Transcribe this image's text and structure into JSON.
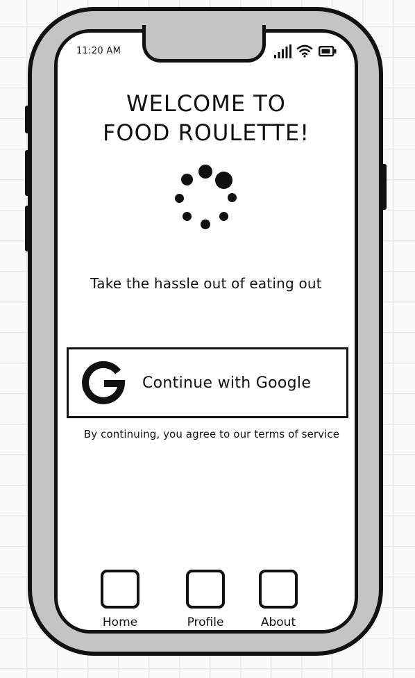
{
  "status_bar": {
    "time": "11:20 AM",
    "icons": [
      "signal-icon",
      "wifi-icon",
      "battery-icon"
    ]
  },
  "main": {
    "title_line1": "WELCOME TO",
    "title_line2": "FOOD ROULETTE!",
    "loading_indicator": "spinner-icon",
    "tagline": "Take the hassle out of eating out"
  },
  "auth": {
    "google_button_label": "Continue with Google",
    "google_icon": "google-g-icon",
    "terms_text": "By continuing, you agree to our terms of service"
  },
  "bottom_nav": {
    "items": [
      {
        "label": "Home"
      },
      {
        "label": "Profile"
      },
      {
        "label": "About"
      }
    ]
  },
  "colors": {
    "stroke": "#111111",
    "frame": "#c4c4c4",
    "screen": "#ffffff"
  }
}
